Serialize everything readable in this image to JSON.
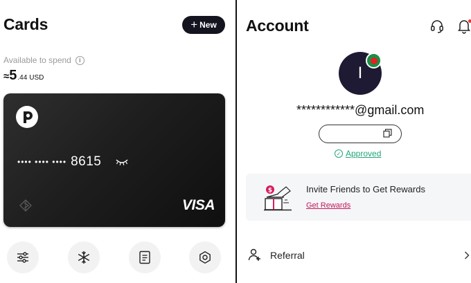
{
  "cards_screen": {
    "title": "Cards",
    "new_button": {
      "plus": "+",
      "label": "New"
    },
    "available_label": "Available to spend",
    "info_symbol": "i",
    "balance": {
      "approx": "≈",
      "integer": "5",
      "decimal": ".44",
      "currency": "USD"
    },
    "card": {
      "masked_groups": "•••• •••• ••••",
      "last4": "8615",
      "network": "VISA",
      "logo_icon": "p-logo-icon",
      "eye_icon": "eye-closed-icon",
      "contactless_icon": "contactless-icon"
    },
    "actions": [
      {
        "icon": "sliders-icon",
        "label": ""
      },
      {
        "icon": "snowflake-icon",
        "label": ""
      },
      {
        "icon": "document-icon",
        "label": ""
      },
      {
        "icon": "hexagon-icon",
        "label": ""
      }
    ]
  },
  "account_screen": {
    "title": "Account",
    "header_icons": [
      "headset-icon",
      "bell-icon"
    ],
    "avatar_initial": "I",
    "email": "************@gmail.com",
    "approved_check": "✓",
    "approved_label": "Approved",
    "invite": {
      "title": "Invite Friends to Get Rewards",
      "link": "Get Rewards",
      "icon": "gift-icon"
    },
    "menu": [
      {
        "label": "Referral",
        "icon": "person-add-icon"
      }
    ]
  },
  "colors": {
    "card_bg": "#1e1e1e",
    "new_button_bg": "#141420",
    "avatar_bg": "#1f1a33",
    "approved": "#20a67a",
    "invite_link": "#c2185b",
    "invite_bg": "#f5f6f8",
    "badge_green": "#1a8f47",
    "badge_red": "#e32222"
  }
}
